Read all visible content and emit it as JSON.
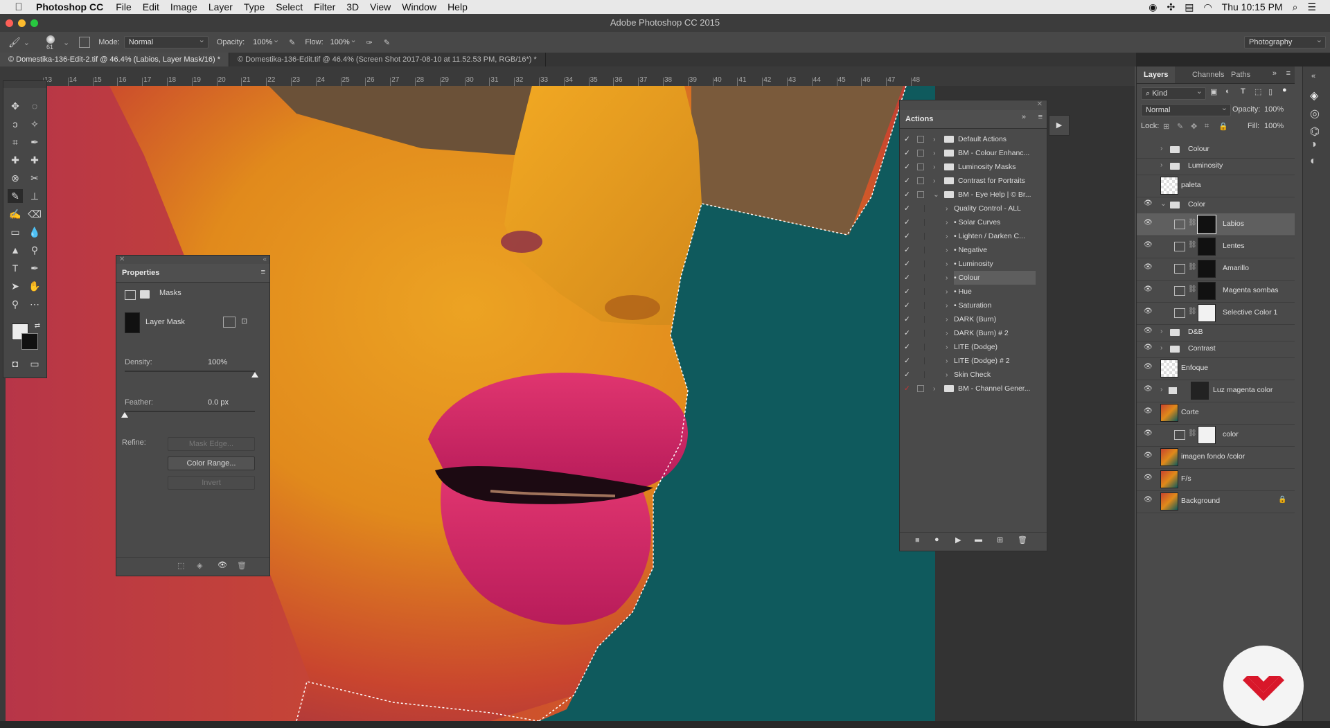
{
  "menubar": {
    "app_name": "Photoshop CC",
    "items": [
      "File",
      "Edit",
      "Image",
      "Layer",
      "Type",
      "Select",
      "Filter",
      "3D",
      "View",
      "Window",
      "Help"
    ],
    "clock": "Thu 10:15 PM"
  },
  "window": {
    "title": "Adobe Photoshop CC 2015"
  },
  "options": {
    "brush_size": "61",
    "mode_label": "Mode:",
    "mode_value": "Normal",
    "opacity_label": "Opacity:",
    "opacity_value": "100%",
    "flow_label": "Flow:",
    "flow_value": "100%",
    "workspace": "Photography"
  },
  "doc_tabs": [
    {
      "label": "© Domestika-136-Edit-2.tif @ 46.4% (Labios, Layer Mask/16) *",
      "active": true
    },
    {
      "label": "© Domestika-136-Edit.tif @ 46.4% (Screen Shot 2017-08-10 at 11.52.53 PM, RGB/16*) *",
      "active": false
    }
  ],
  "ruler_ticks": [
    "13",
    "14",
    "15",
    "16",
    "17",
    "18",
    "19",
    "20",
    "21",
    "22",
    "23",
    "24",
    "25",
    "26",
    "27",
    "28",
    "29",
    "30",
    "31",
    "32",
    "33",
    "34",
    "35",
    "36",
    "37",
    "38",
    "39",
    "40",
    "41",
    "42",
    "43",
    "44",
    "45",
    "46",
    "47",
    "48"
  ],
  "properties": {
    "title": "Properties",
    "section": "Masks",
    "mask_type": "Layer Mask",
    "density_label": "Density:",
    "density_value": "100%",
    "density_level": 1.0,
    "feather_label": "Feather:",
    "feather_value": "0.0 px",
    "feather_level": 0.0,
    "refine_label": "Refine:",
    "mask_edge": "Mask Edge...",
    "color_range": "Color Range...",
    "invert": "Invert"
  },
  "actions": {
    "title": "Actions",
    "rows": [
      {
        "label": "Default Actions",
        "indent": 0,
        "folder": true
      },
      {
        "label": "BM - Colour Enhanc...",
        "indent": 0,
        "folder": true
      },
      {
        "label": "Luminosity Masks",
        "indent": 0,
        "folder": true
      },
      {
        "label": "Contrast for Portraits",
        "indent": 0,
        "folder": true
      },
      {
        "label": "BM - Eye Help | © Br...",
        "indent": 0,
        "folder": true,
        "open": true
      },
      {
        "label": "Quality Control - ALL",
        "indent": 1
      },
      {
        "label": "• Solar Curves",
        "indent": 1
      },
      {
        "label": "• Lighten / Darken C...",
        "indent": 1
      },
      {
        "label": "• Negative",
        "indent": 1
      },
      {
        "label": "• Luminosity",
        "indent": 1
      },
      {
        "label": "• Colour",
        "indent": 1,
        "selected": true
      },
      {
        "label": "• Hue",
        "indent": 1
      },
      {
        "label": "• Saturation",
        "indent": 1
      },
      {
        "label": "DARK (Burn)",
        "indent": 1
      },
      {
        "label": "DARK (Burn) # 2",
        "indent": 1
      },
      {
        "label": "LITE (Dodge)",
        "indent": 1
      },
      {
        "label": "LITE (Dodge) # 2",
        "indent": 1
      },
      {
        "label": "Skin Check",
        "indent": 1
      },
      {
        "label": "BM - Channel Gener...",
        "indent": 0,
        "folder": true,
        "red": true
      }
    ]
  },
  "layers_panel": {
    "tabs": [
      "Layers",
      "Channels",
      "Paths"
    ],
    "kind": "Kind",
    "blend": "Normal",
    "opacity_label": "Opacity:",
    "opacity_value": "100%",
    "lock_label": "Lock:",
    "fill_label": "Fill:",
    "fill_value": "100%",
    "layers": [
      {
        "name": "Colour",
        "type": "group",
        "visible": false
      },
      {
        "name": "Luminosity",
        "type": "group",
        "visible": false
      },
      {
        "name": "paleta",
        "type": "pixel",
        "visible": false
      },
      {
        "name": "Color",
        "type": "group-open",
        "visible": true
      },
      {
        "name": "Labios",
        "type": "adj-mask",
        "visible": true,
        "selected": true
      },
      {
        "name": "Lentes",
        "type": "adj-mask",
        "visible": true
      },
      {
        "name": "Amarillo",
        "type": "adj-mask",
        "visible": true
      },
      {
        "name": "Magenta sombas",
        "type": "adj-mask",
        "visible": true
      },
      {
        "name": "Selective Color 1",
        "type": "adj-white",
        "visible": true
      },
      {
        "name": "D&B",
        "type": "group",
        "visible": true
      },
      {
        "name": "Contrast",
        "type": "group",
        "visible": true
      },
      {
        "name": "Enfoque",
        "type": "pixel",
        "visible": true
      },
      {
        "name": "Luz magenta color",
        "type": "group-mask",
        "visible": true
      },
      {
        "name": "Corte",
        "type": "photo",
        "visible": true
      },
      {
        "name": "color",
        "type": "adj-white",
        "visible": true
      },
      {
        "name": "imagen fondo /color",
        "type": "photo",
        "visible": true
      },
      {
        "name": "F/s",
        "type": "photo",
        "visible": true
      },
      {
        "name": "Background",
        "type": "photo",
        "visible": true,
        "locked": true
      }
    ]
  },
  "colors": {
    "teal": "#0e5a5c",
    "skin_orange": "#e08a1a",
    "skin_red": "#c8442e",
    "lips": "#d0266a",
    "brand_red": "#d8172a"
  }
}
